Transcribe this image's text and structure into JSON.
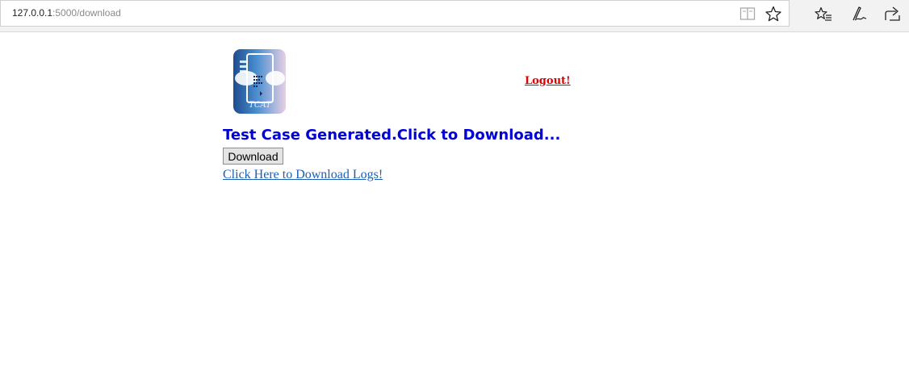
{
  "browser": {
    "url_host": "127.0.0.1",
    "url_rest": ":5000/download",
    "icons": [
      "reading-view-icon",
      "favorite-star-icon",
      "favorites-list-icon",
      "pen-ink-icon",
      "share-icon"
    ]
  },
  "page": {
    "logo_text": "TCAT",
    "logout_label": "Logout!",
    "heading": "Test Case Generated.Click to Download...",
    "download_button": "Download",
    "logs_link": "Click Here to Download Logs!"
  },
  "colors": {
    "heading": "#0000d8",
    "logout": "#e00000",
    "link": "#1a5fb4"
  }
}
